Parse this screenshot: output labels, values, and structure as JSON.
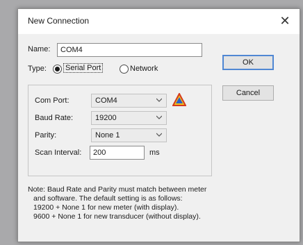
{
  "dialog": {
    "title": "New Connection",
    "close_glyph": "✕"
  },
  "form": {
    "name_label": "Name:",
    "name_value": "COM4",
    "type_label": "Type:",
    "type_options": [
      "Serial Port",
      "Network"
    ],
    "type_selected": "Serial Port"
  },
  "buttons": {
    "ok": "OK",
    "cancel": "Cancel"
  },
  "serial": {
    "com_port_label": "Com Port:",
    "com_port_value": "COM4",
    "baud_label": "Baud Rate:",
    "baud_value": "19200",
    "parity_label": "Parity:",
    "parity_value": "None 1",
    "scan_label": "Scan Interval:",
    "scan_value": "200",
    "scan_unit": "ms",
    "warning_icon": "warning-triangle-icon"
  },
  "note": {
    "line1": "Note:  Baud Rate and Parity must match between meter",
    "line2": "and software. The default setting is as follows:",
    "line3": "19200 + None 1 for new meter (with display).",
    "line4": "9600 + None 1 for new transducer (without display)."
  },
  "colors": {
    "default_button_border": "#4f87d3",
    "warning_yellow": "#f2c21b",
    "warning_red": "#d43a1e",
    "warning_blue": "#2c5fc8"
  }
}
